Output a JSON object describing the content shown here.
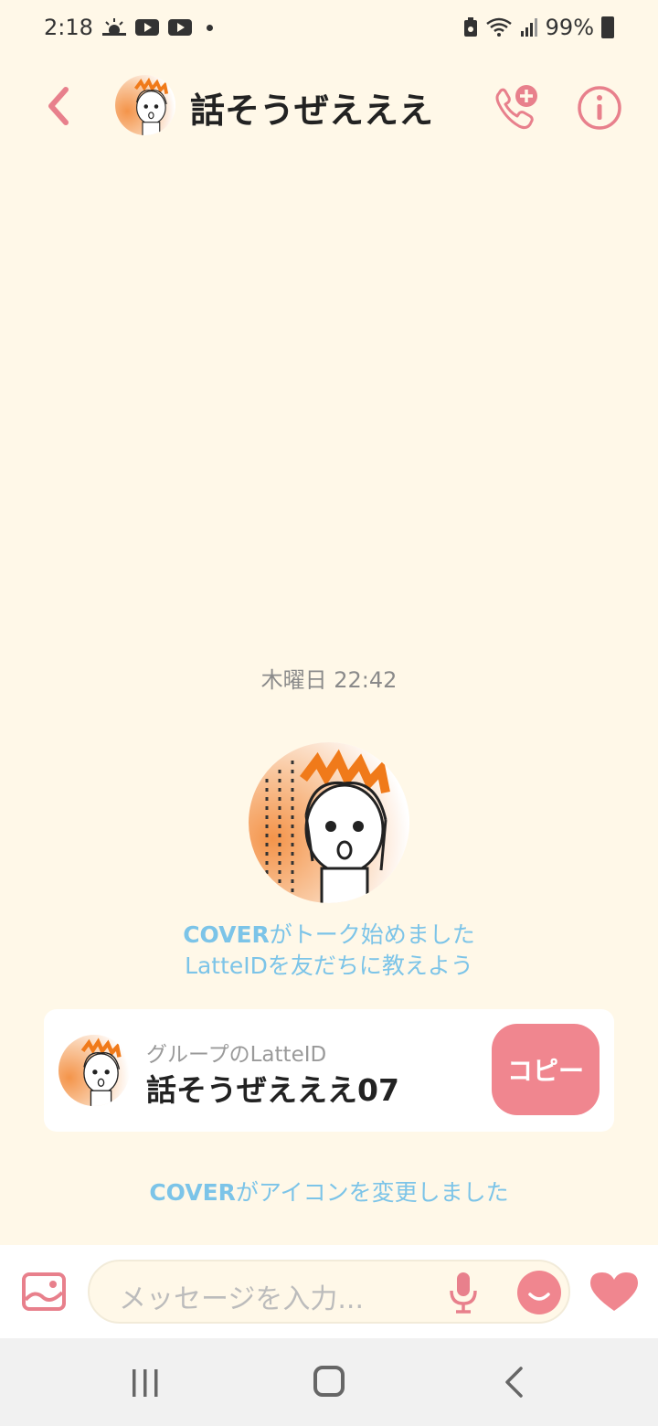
{
  "status_bar": {
    "time": "2:18",
    "battery": "99%",
    "icons": [
      "weather-icon",
      "youtube-icon",
      "youtube-icon",
      "notification-dot-icon",
      "recycle-icon",
      "wifi-icon",
      "signal-icon",
      "battery-icon"
    ]
  },
  "header": {
    "title": "話そうぜえええ",
    "back_icon": "chevron-left-icon",
    "call_icon": "phone-add-icon",
    "info_icon": "info-icon"
  },
  "chat": {
    "timestamp": "木曜日 22:42",
    "started_user": "COVER",
    "started_text": "がトーク始めました",
    "invite_text": "LatteIDを友だちに教えよう",
    "id_card": {
      "label": "グループのLatteID",
      "id": "話そうぜえええ07",
      "copy_label": "コピー"
    },
    "icon_change_user": "COVER",
    "icon_change_text": "がアイコンを変更しました"
  },
  "input_bar": {
    "placeholder": "メッセージを入力...",
    "photo_icon": "image-icon",
    "mic_icon": "microphone-icon",
    "emoji_icon": "emoji-icon",
    "heart_icon": "heart-icon"
  },
  "nav": {
    "recent_icon": "recent-apps-icon",
    "home_icon": "home-icon",
    "back_icon": "back-icon"
  },
  "colors": {
    "background": "#fff8e8",
    "accent_pink": "#f0868f",
    "system_blue": "#7cc4e8"
  }
}
